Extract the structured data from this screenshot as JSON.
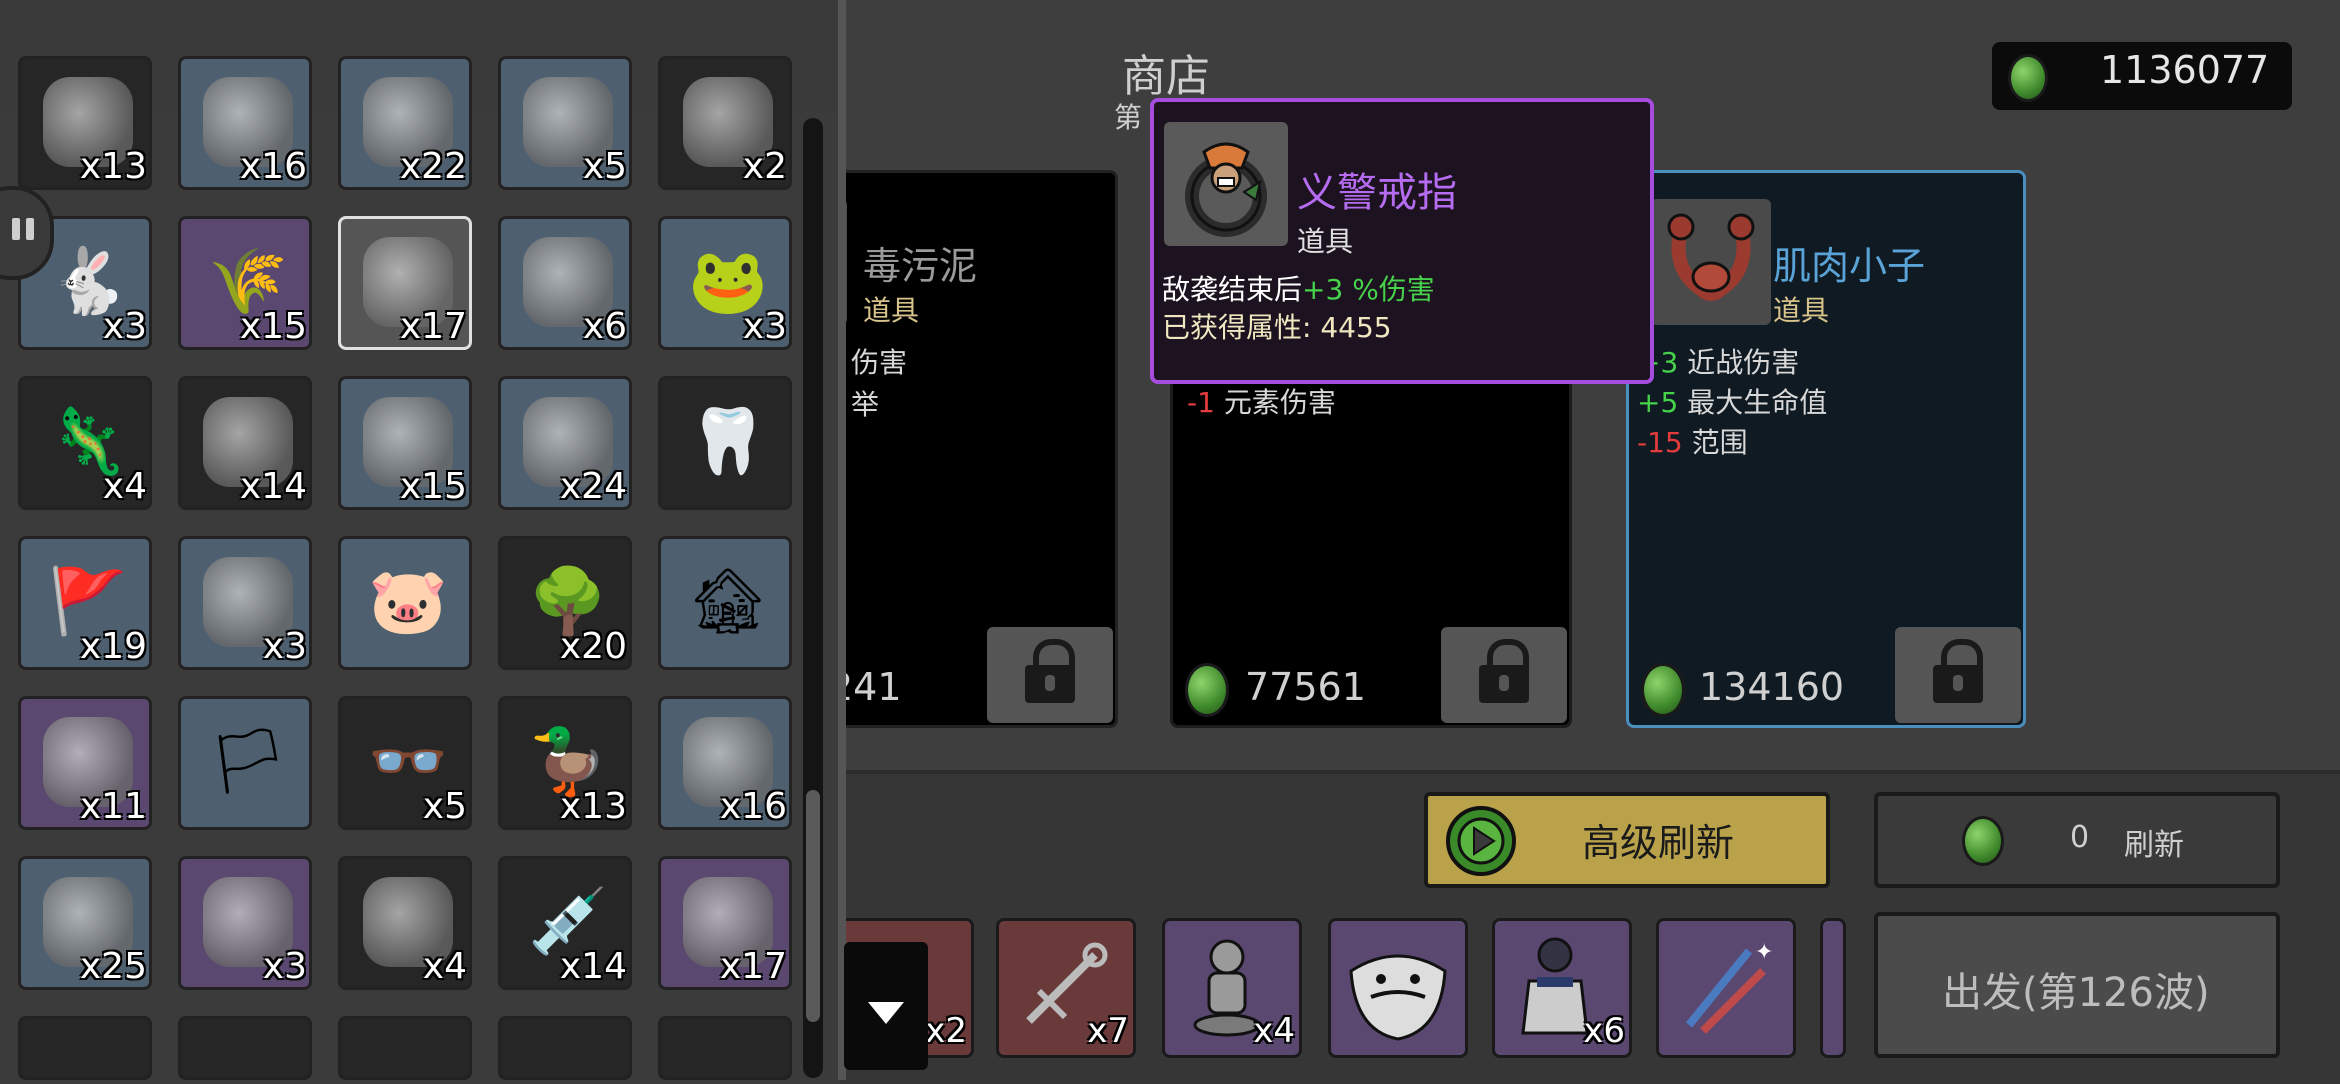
{
  "shop": {
    "title": "商店",
    "wave_label": "第",
    "money": "1136077",
    "cards": [
      {
        "name": "毒污泥",
        "type": "道具",
        "stats": [
          "伤害",
          "举"
        ],
        "price": "241"
      },
      {
        "name": "",
        "type": "",
        "stats": [
          {
            "value": "-1",
            "label": "元素伤害"
          }
        ],
        "price": "77561"
      },
      {
        "name": "肌肉小子",
        "type": "道具",
        "stats": [
          {
            "value": "+3",
            "label": "近战伤害"
          },
          {
            "value": "+5",
            "label": "最大生命值"
          },
          {
            "value": "-15",
            "label": "范围"
          }
        ],
        "price": "134160"
      }
    ]
  },
  "tooltip": {
    "name": "义警戒指",
    "type": "道具",
    "effect_prefix": "敌袭结束后",
    "effect_value": "+3 %伤害",
    "acquired_label": "已获得属性:",
    "acquired_value": "4455"
  },
  "buttons": {
    "advanced_refresh": "高级刷新",
    "refresh_cost": "0",
    "refresh": "刷新",
    "depart": "出发(第126波)"
  },
  "weapons": [
    {
      "count": "x2",
      "tier": "red"
    },
    {
      "count": "x7",
      "tier": "red"
    },
    {
      "count": "x4",
      "tier": "purple"
    },
    {
      "count": "",
      "tier": "purple"
    },
    {
      "count": "x6",
      "tier": "purple"
    },
    {
      "count": "",
      "tier": "purple"
    }
  ],
  "inventory": [
    {
      "count": "x13",
      "tier": "dark",
      "icon": "ice-icon"
    },
    {
      "count": "x16",
      "tier": "blue",
      "icon": "bowl-icon"
    },
    {
      "count": "x22",
      "tier": "blue",
      "icon": "stand-icon"
    },
    {
      "count": "x5",
      "tier": "blue",
      "icon": "shovel-icon"
    },
    {
      "count": "x2",
      "tier": "dark",
      "icon": "meat-icon"
    },
    {
      "count": "x3",
      "tier": "blue",
      "icon": "rabbit-icon"
    },
    {
      "count": "x15",
      "tier": "purple",
      "icon": "wheat-icon"
    },
    {
      "count": "x17",
      "tier": "gray-selected",
      "icon": "ring-icon"
    },
    {
      "count": "x6",
      "tier": "blue",
      "icon": "cloth-icon"
    },
    {
      "count": "x3",
      "tier": "blue",
      "icon": "frog-icon"
    },
    {
      "count": "x4",
      "tier": "dark",
      "icon": "lizard-icon"
    },
    {
      "count": "x14",
      "tier": "dark",
      "icon": "sack-icon"
    },
    {
      "count": "x15",
      "tier": "blue",
      "icon": "barrel-icon"
    },
    {
      "count": "x24",
      "tier": "blue",
      "icon": "wheelbarrow-icon"
    },
    {
      "count": "",
      "tier": "dark",
      "icon": "tooth-icon"
    },
    {
      "count": "x19",
      "tier": "blue",
      "icon": "banner-icon"
    },
    {
      "count": "x3",
      "tier": "blue",
      "icon": "ladder-icon"
    },
    {
      "count": "",
      "tier": "blue",
      "icon": "piggy-bank-icon"
    },
    {
      "count": "x20",
      "tier": "dark",
      "icon": "tree-icon"
    },
    {
      "count": "",
      "tier": "blue",
      "icon": "house-icon"
    },
    {
      "count": "x11",
      "tier": "purple",
      "icon": "zombie-icon"
    },
    {
      "count": "",
      "tier": "blue",
      "icon": "white-flag-icon"
    },
    {
      "count": "x5",
      "tier": "dark",
      "icon": "glasses-icon"
    },
    {
      "count": "x13",
      "tier": "dark",
      "icon": "duck-icon"
    },
    {
      "count": "x16",
      "tier": "blue",
      "icon": "hook-icon"
    },
    {
      "count": "x25",
      "tier": "blue",
      "icon": "flashlight-icon"
    },
    {
      "count": "x3",
      "tier": "purple",
      "icon": "alien-icon"
    },
    {
      "count": "x4",
      "tier": "dark",
      "icon": "mask-icon"
    },
    {
      "count": "x14",
      "tier": "dark",
      "icon": "syringe-icon"
    },
    {
      "count": "x17",
      "tier": "purple",
      "icon": "tardigrade-icon"
    }
  ],
  "colors": {
    "tier_blue": "#4e6070",
    "tier_purple": "#5b4870",
    "tier_dark": "#262626",
    "tier_red": "#6a3a3a",
    "tooltip_border": "#a64de0",
    "tooltip_name": "#b56cf0",
    "stat_green": "#46d24a",
    "stat_red": "#e33c3c"
  }
}
